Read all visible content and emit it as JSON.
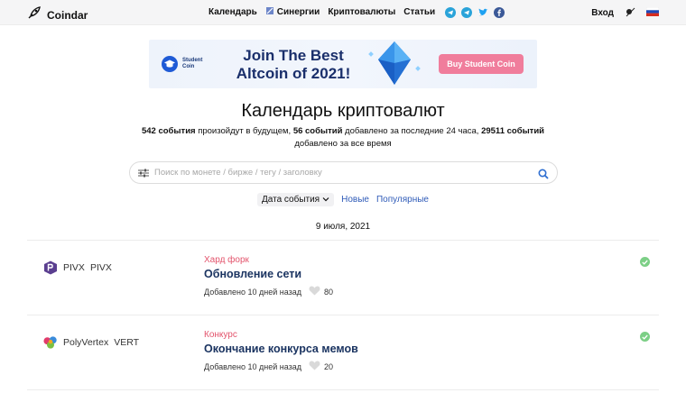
{
  "header": {
    "logo_text": "Coindar",
    "nav": [
      {
        "label": "Календарь"
      },
      {
        "label": "Синергии"
      },
      {
        "label": "Криптовалюты"
      },
      {
        "label": "Статьи"
      }
    ],
    "login": "Вход",
    "social_icons": [
      "telegram-icon",
      "telegram-icon",
      "twitter-icon",
      "facebook-icon"
    ],
    "language_flag": "russia-flag"
  },
  "banner": {
    "brand_line1": "Student",
    "brand_line2": "Coin",
    "title_line1": "Join The Best",
    "title_line2": "Altcoin of 2021!",
    "button": "Buy Student Coin"
  },
  "page": {
    "title": "Календарь криптовалют",
    "stats": {
      "future_count": "542 события",
      "future_text": " произойдут в будущем, ",
      "day_count": "56 событий",
      "day_text": " добавлено за последние 24 часа, ",
      "total_count": "29511 событий",
      "total_text": "добавлено за все время"
    },
    "search_placeholder": "Поиск по монете / бирже / тегу / заголовку",
    "sort": {
      "selected": "Дата события",
      "options": [
        "Новые",
        "Популярные"
      ]
    },
    "date": "9 июля, 2021"
  },
  "events": [
    {
      "coin": "PIVX",
      "symbol": "PIVX",
      "category": "Хард форк",
      "title": "Обновление сети",
      "added": "Добавлено 10 дней назад",
      "likes": "80"
    },
    {
      "coin": "PolyVertex",
      "symbol": "VERT",
      "category": "Конкурс",
      "title": "Окончание конкурса мемов",
      "added": "Добавлено 10 дней назад",
      "likes": "20"
    }
  ],
  "colors": {
    "category": "#e3546c",
    "event_title": "#1b3461",
    "link": "#2f5bb8",
    "banner_button": "#f07d9c",
    "check": "#7ccf86"
  }
}
